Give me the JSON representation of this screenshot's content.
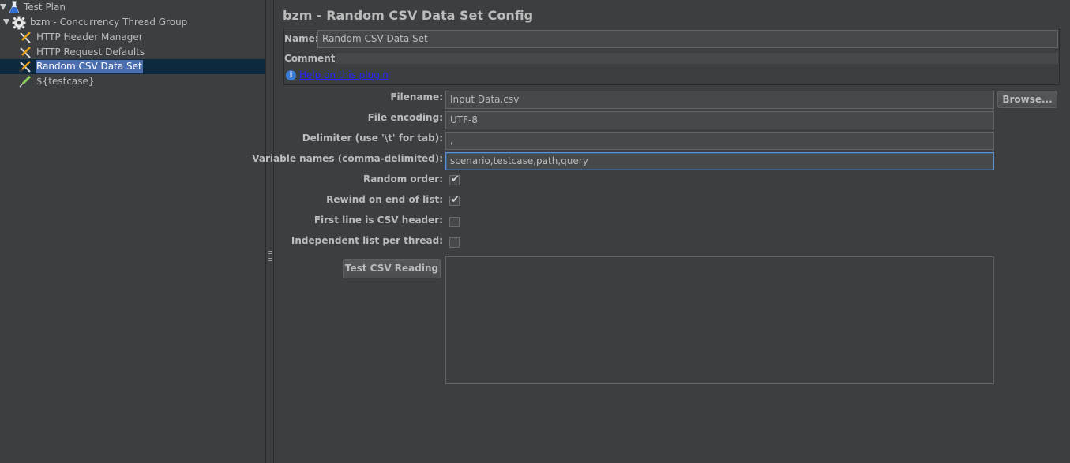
{
  "tree": {
    "items": [
      {
        "label": "Test Plan",
        "icon": "flask-icon"
      },
      {
        "label": "bzm - Concurrency Thread Group",
        "icon": "gear-icon"
      },
      {
        "label": "HTTP Header Manager",
        "icon": "wrench-screwdriver-icon"
      },
      {
        "label": "HTTP Request Defaults",
        "icon": "wrench-screwdriver-icon"
      },
      {
        "label": "Random CSV Data Set",
        "icon": "wrench-screwdriver-icon",
        "selected": true
      },
      {
        "label": "${testcase}",
        "icon": "pipette-icon"
      }
    ]
  },
  "main": {
    "title": "bzm - Random CSV Data Set Config",
    "name_label": "Name:",
    "name_value": "Random CSV Data Set",
    "comments_label": "Comments:",
    "comments_value": "",
    "help_link": "Help on this plugin",
    "filename_label": "Filename:",
    "filename_value": "Input Data.csv",
    "browse_label": "Browse...",
    "encoding_label": "File encoding:",
    "encoding_value": "UTF-8",
    "delimiter_label": "Delimiter (use '\\t' for tab):",
    "delimiter_value": ",",
    "varnames_label": "Variable names (comma-delimited):",
    "varnames_value": "scenario,testcase,path,query",
    "random_order_label": "Random order:",
    "random_order_checked": true,
    "rewind_label": "Rewind on end of list:",
    "rewind_checked": true,
    "first_line_header_label": "First line is CSV header:",
    "first_line_header_checked": false,
    "independent_label": "Independent list per thread:",
    "independent_checked": false,
    "test_button_label": "Test CSV Reading",
    "output_text": ""
  },
  "colors": {
    "background": "#3c3f41",
    "selection": "#4b6eaf",
    "link": "#2222ff",
    "field": "#45494a"
  }
}
